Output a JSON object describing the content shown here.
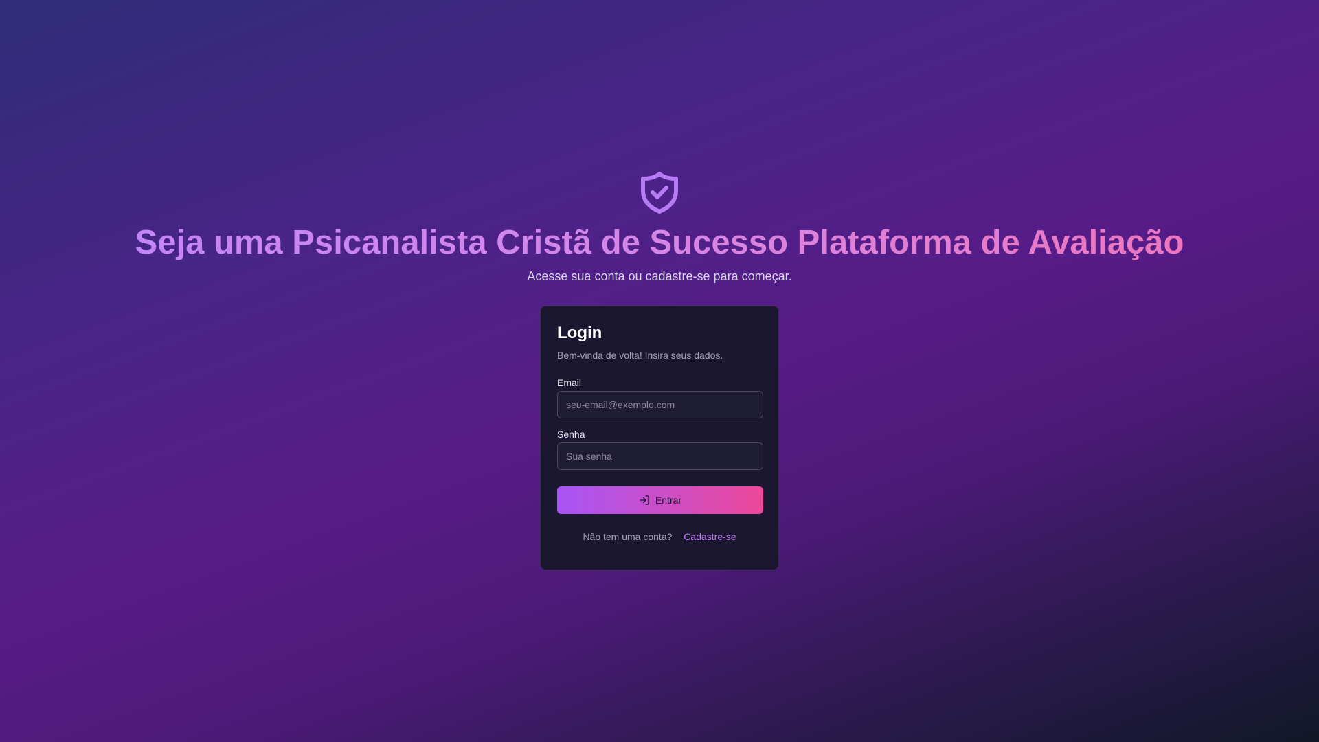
{
  "header": {
    "icon": "shield-check-icon",
    "title": "Seja uma Psicanalista Cristã de Sucesso Plataforma de Avaliação",
    "subtitle": "Acesse sua conta ou cadastre-se para começar."
  },
  "login_card": {
    "title": "Login",
    "description": "Bem-vinda de volta! Insira seus dados.",
    "email": {
      "label": "Email",
      "placeholder": "seu-email@exemplo.com",
      "value": ""
    },
    "password": {
      "label": "Senha",
      "placeholder": "Sua senha",
      "value": ""
    },
    "submit": {
      "icon": "log-in-icon",
      "label": "Entrar"
    },
    "signup_prompt": "Não tem uma conta?",
    "signup_link": "Cadastre-se"
  },
  "colors": {
    "accent_start": "#a855f7",
    "accent_end": "#ec4899",
    "card_background": "#1c1730",
    "link": "#c07af5"
  }
}
